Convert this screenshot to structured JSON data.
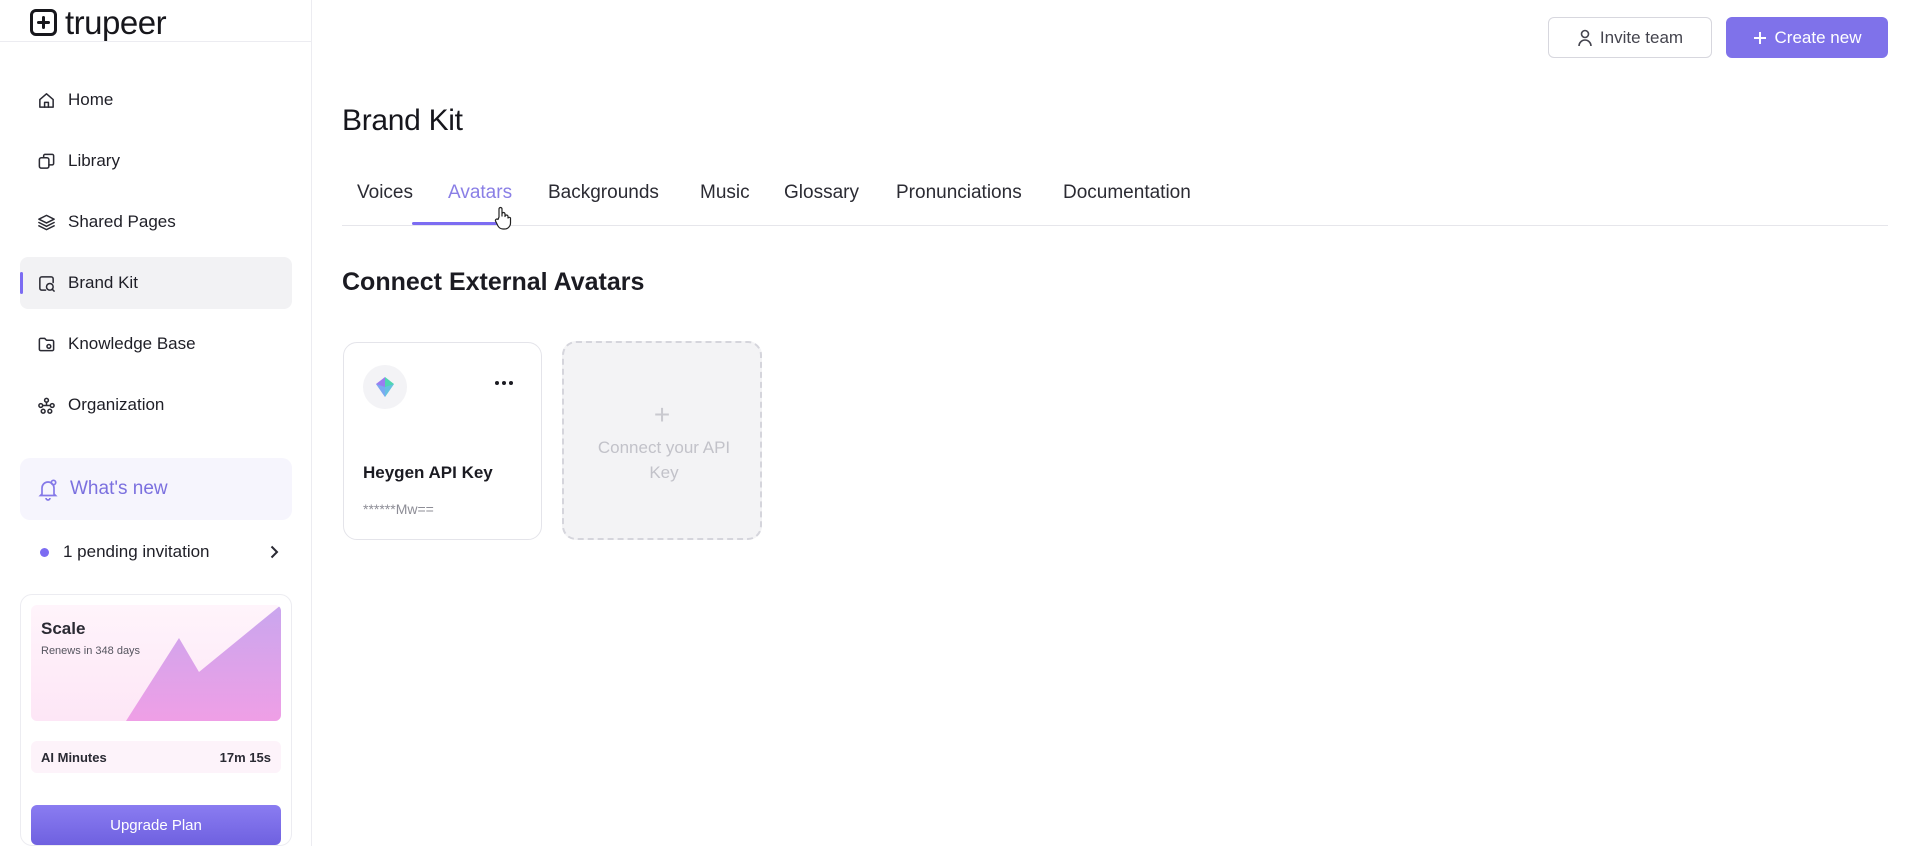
{
  "app": {
    "logo_text": "trupeer"
  },
  "sidebar": {
    "items": [
      {
        "label": "Home",
        "icon": "home-icon",
        "active": false
      },
      {
        "label": "Library",
        "icon": "library-icon",
        "active": false
      },
      {
        "label": "Shared Pages",
        "icon": "layers-icon",
        "active": false
      },
      {
        "label": "Brand Kit",
        "icon": "brand-kit-icon",
        "active": true
      },
      {
        "label": "Knowledge Base",
        "icon": "folder-icon",
        "active": false
      },
      {
        "label": "Organization",
        "icon": "organization-icon",
        "active": false
      }
    ],
    "whats_new": {
      "label": "What's new",
      "icon": "bell-icon"
    },
    "pending": {
      "label": "1 pending invitation",
      "icon": "chevron-right-icon"
    },
    "plan": {
      "name": "Scale",
      "renews": "Renews in 348 days",
      "minutes_label": "AI Minutes",
      "minutes_value": "17m 15s",
      "upgrade_label": "Upgrade Plan"
    }
  },
  "header": {
    "invite_label": "Invite team",
    "create_label": "Create new"
  },
  "main": {
    "title": "Brand Kit",
    "tabs": [
      {
        "label": "Voices",
        "active": false
      },
      {
        "label": "Avatars",
        "active": true
      },
      {
        "label": "Backgrounds",
        "active": false
      },
      {
        "label": "Music",
        "active": false
      },
      {
        "label": "Glossary",
        "active": false
      },
      {
        "label": "Pronunciations",
        "active": false
      },
      {
        "label": "Documentation",
        "active": false
      }
    ],
    "section_title": "Connect External Avatars",
    "key_card": {
      "name": "Heygen API Key",
      "masked_key": "******Mw==",
      "logo": "heygen-logo-icon"
    },
    "connect_card": {
      "label": "Connect your API Key"
    }
  },
  "colors": {
    "accent": "#7f72ea",
    "active_tab": "#8a7fe6",
    "sidebar_active_bg": "#f2f2f4"
  }
}
